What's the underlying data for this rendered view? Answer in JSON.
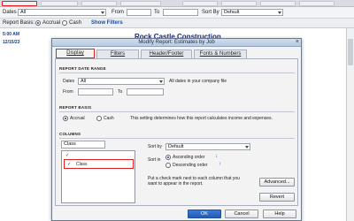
{
  "report": {
    "dates_label": "Dates",
    "dates_value": "All",
    "from_label": "From",
    "to_label": "To",
    "sort_label": "Sort By",
    "sort_value": "Default",
    "basis_label": "Report Basis:",
    "basis_accrual": "Accrual",
    "basis_cash": "Cash",
    "show_filters": "Show Filters",
    "time": "5:00 AM",
    "date": "12/15/23",
    "company": "Rock Castle Construction"
  },
  "dialog": {
    "title": "Modify Report: Estimates by Job",
    "close_glyph": "×",
    "tabs": [
      {
        "label": "Display"
      },
      {
        "label": "Filters"
      },
      {
        "label": "Header/Footer"
      },
      {
        "label": "Fonts & Numbers"
      }
    ],
    "date_range": {
      "section": "REPORT DATE RANGE",
      "dates_label": "Dates",
      "dates_value": "All",
      "dates_note": "All dates in your company file",
      "from_label": "From",
      "to_label": "To"
    },
    "basis": {
      "section": "REPORT BASIS",
      "accrual": "Accrual",
      "cash": "Cash",
      "note": "This setting determines how this report calculates income and expenses."
    },
    "columns": {
      "section": "COLUMNS",
      "search_value": "Class",
      "check_glyph": "✓",
      "item_label": "Class",
      "sort_by_label": "Sort by",
      "sort_by_value": "Default",
      "sort_in_label": "Sort in",
      "ascending": "Ascending order",
      "descending": "Descending order",
      "hint": "Put a check mark next to each column that you want to appear in the report.",
      "advanced": "Advanced...",
      "revert": "Revert"
    },
    "buttons": {
      "ok": "OK",
      "cancel": "Cancel",
      "help": "Help"
    }
  },
  "colors": {
    "highlight": "#e02020",
    "ok_button": "#2a64c4",
    "company_title": "#1a2e6e"
  }
}
